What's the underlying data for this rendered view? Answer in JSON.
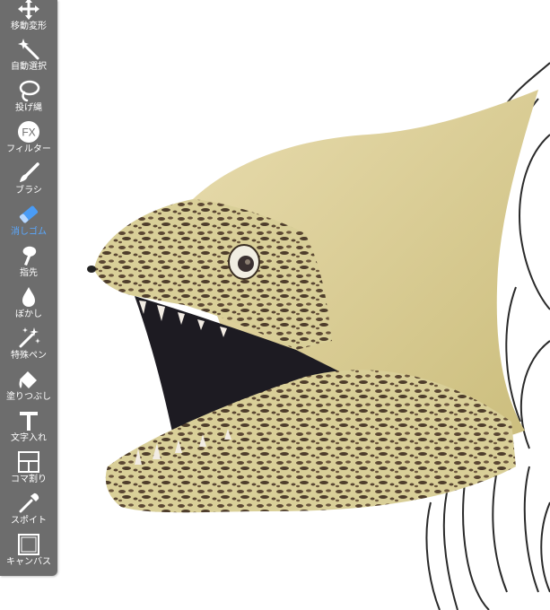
{
  "app": {
    "accent_color": "#4a9cf6",
    "toolbar_color": "#6d6d6d",
    "label_color": "#ffffff"
  },
  "toolbar": {
    "active_tool": "消しゴム",
    "tools": [
      {
        "label": "移動変形",
        "icon": "move-arrows-icon"
      },
      {
        "label": "自動選択",
        "icon": "magic-wand-icon"
      },
      {
        "label": "投げ縄",
        "icon": "lasso-icon"
      },
      {
        "label": "フィルター",
        "icon": "fx-icon"
      },
      {
        "label": "ブラシ",
        "icon": "brush-icon"
      },
      {
        "label": "消しゴム",
        "icon": "eraser-icon"
      },
      {
        "label": "指先",
        "icon": "finger-smudge-icon"
      },
      {
        "label": "ぼかし",
        "icon": "drop-icon"
      },
      {
        "label": "特殊ペン",
        "icon": "sparkle-pen-icon"
      },
      {
        "label": "塗りつぶし",
        "icon": "fill-bucket-icon"
      },
      {
        "label": "文字入れ",
        "icon": "text-t-icon"
      },
      {
        "label": "コマ割り",
        "icon": "frame-panels-icon"
      },
      {
        "label": "スポイト",
        "icon": "eyedropper-icon"
      },
      {
        "label": "キャンバス",
        "icon": "canvas-icon"
      }
    ]
  },
  "canvas": {
    "artwork": "moray-eel-illustration"
  }
}
